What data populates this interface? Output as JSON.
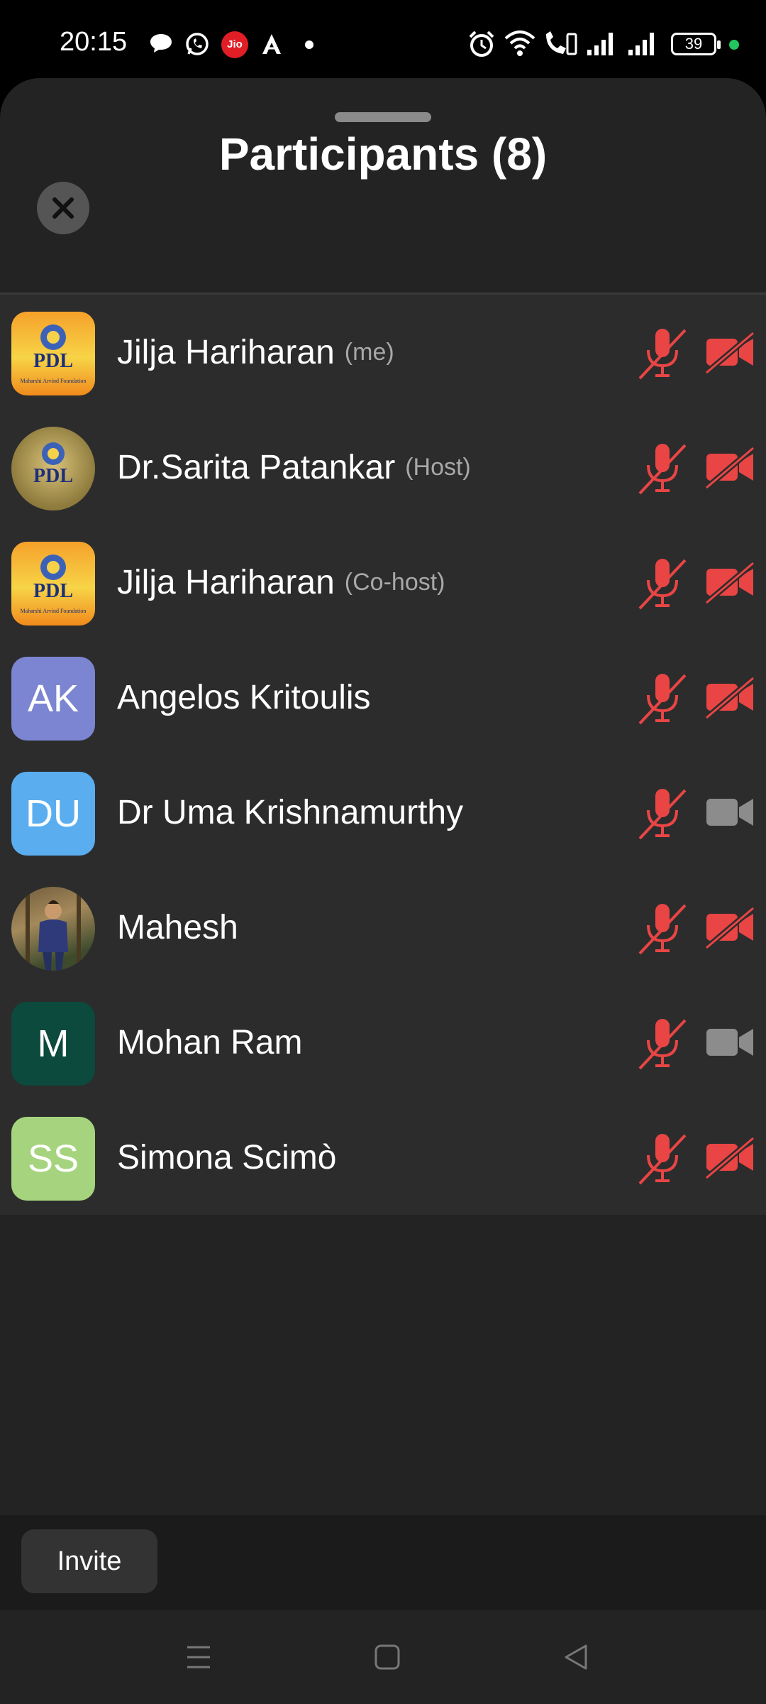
{
  "status_bar": {
    "time": "20:15",
    "notification_icons": [
      "chat-bubble-icon",
      "whatsapp-icon",
      "jio-icon",
      "arrow-app-icon",
      "dot-icon"
    ],
    "jio_text": "Jio",
    "battery": "39",
    "right_icons": [
      "alarm-icon",
      "wifi-icon",
      "volte-call-icon",
      "signal-icon",
      "signal-icon"
    ]
  },
  "sheet": {
    "title": "Participants (8)",
    "close_icon": "close-icon"
  },
  "participants": [
    {
      "name": "Jilja Hariharan",
      "role": "(me)",
      "avatar": "pdl-logo",
      "mic": "muted",
      "video": "off"
    },
    {
      "name": "Dr.Sarita Patankar",
      "role": "(Host)",
      "avatar": "pdl-logo",
      "mic": "muted",
      "video": "off"
    },
    {
      "name": "Jilja Hariharan",
      "role": "(Co-host)",
      "avatar": "pdl-logo",
      "mic": "muted",
      "video": "off"
    },
    {
      "name": "Angelos Kritoulis",
      "role": "",
      "initials": "AK",
      "avatar_color": "#7b85d1",
      "mic": "muted",
      "video": "off"
    },
    {
      "name": "Dr Uma Krishnamurthy",
      "role": "",
      "initials": "DU",
      "avatar_color": "#5aaef0",
      "mic": "muted",
      "video": "on"
    },
    {
      "name": "Mahesh",
      "role": "",
      "avatar": "photo",
      "mic": "muted",
      "video": "off"
    },
    {
      "name": "Mohan Ram",
      "role": "",
      "initials": "M",
      "avatar_color": "#0b4a3c",
      "mic": "muted",
      "video": "on"
    },
    {
      "name": "Simona Scimò",
      "role": "",
      "initials": "SS",
      "avatar_color": "#a6d47e",
      "mic": "muted",
      "video": "off"
    }
  ],
  "pdl_logo": {
    "text": "PDL",
    "caption": "Maharshi Arvind Foundation"
  },
  "footer": {
    "invite_label": "Invite"
  },
  "colors": {
    "muted_red": "#e94545",
    "video_on_gray": "#8c8c8c",
    "sheet_bg": "#232323",
    "list_bg": "#2c2c2c"
  },
  "nav_bar": {
    "icons": [
      "menu-icon",
      "home-icon",
      "back-icon"
    ]
  }
}
